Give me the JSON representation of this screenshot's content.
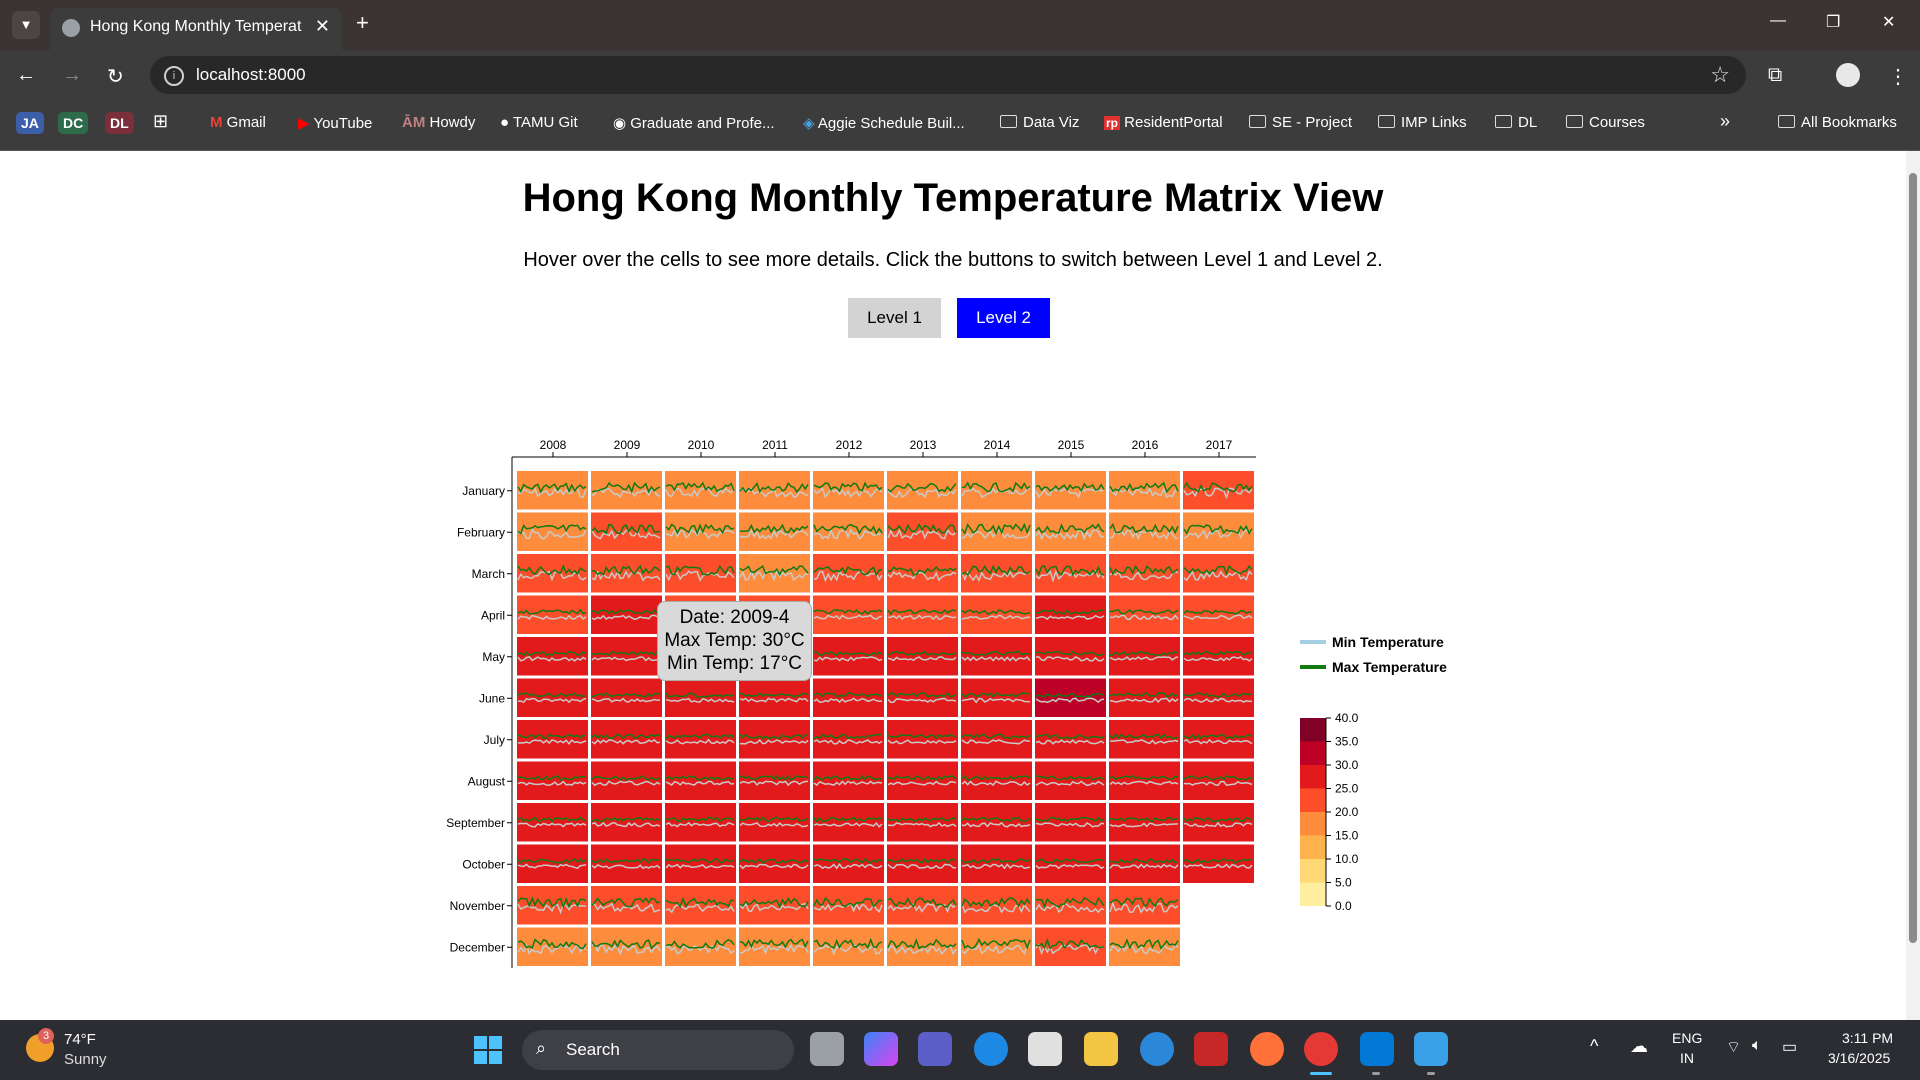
{
  "browser": {
    "tab_title": "Hong Kong Monthly Temperatu",
    "url": "localhost:8000",
    "bookmarks": [
      "JA",
      "DC",
      "DL",
      "Gmail",
      "YouTube",
      "Howdy",
      "TAMU Git",
      "Graduate and Profe...",
      "Aggie Schedule Buil...",
      "Data Viz",
      "ResidentPortal",
      "SE - Project",
      "IMP Links",
      "DL",
      "Courses",
      "All Bookmarks"
    ]
  },
  "page": {
    "title": "Hong Kong Monthly Temperature Matrix View",
    "subtitle": "Hover over the cells to see more details. Click the buttons to switch between Level 1 and Level 2.",
    "button_level1": "Level 1",
    "button_level2": "Level 2",
    "active_level": "Level 2"
  },
  "tooltip": {
    "date": "Date: 2009-4",
    "max": "Max Temp: 30°C",
    "min": "Min Temp: 17°C"
  },
  "chart_data": {
    "type": "heatmap",
    "title": "Hong Kong Monthly Temperature Matrix View",
    "years": [
      "2008",
      "2009",
      "2010",
      "2011",
      "2012",
      "2013",
      "2014",
      "2015",
      "2016",
      "2017"
    ],
    "months": [
      "January",
      "February",
      "March",
      "April",
      "May",
      "June",
      "July",
      "August",
      "September",
      "October",
      "November",
      "December"
    ],
    "monthly_max_temp_c": [
      [
        20,
        21,
        21,
        20,
        20,
        22,
        21,
        21,
        21,
        23
      ],
      [
        18,
        23,
        22,
        21,
        21,
        23,
        20,
        22,
        21,
        22
      ],
      [
        23,
        24,
        23,
        22,
        23,
        24,
        24,
        24,
        23,
        24
      ],
      [
        26,
        30,
        25,
        26,
        27,
        26,
        26,
        28,
        27,
        27
      ],
      [
        30,
        30,
        30,
        30,
        30,
        30,
        30,
        31,
        30,
        30
      ],
      [
        31,
        32,
        31,
        32,
        31,
        32,
        32,
        33,
        32,
        32
      ],
      [
        32,
        32,
        32,
        32,
        32,
        32,
        32,
        32,
        32,
        32
      ],
      [
        32,
        32,
        32,
        32,
        32,
        32,
        32,
        32,
        32,
        32
      ],
      [
        31,
        32,
        31,
        31,
        31,
        31,
        32,
        31,
        32,
        31
      ],
      [
        29,
        29,
        28,
        28,
        29,
        28,
        29,
        30,
        30,
        29
      ],
      [
        25,
        26,
        25,
        26,
        25,
        25,
        25,
        27,
        26,
        null
      ],
      [
        21,
        22,
        21,
        20,
        21,
        20,
        20,
        23,
        22,
        null
      ]
    ],
    "legend": {
      "lines": [
        {
          "name": "Min Temperature",
          "color": "#a6cee3"
        },
        {
          "name": "Max Temperature",
          "color": "#117a11"
        }
      ],
      "scale_ticks": [
        "40.0",
        "35.0",
        "30.0",
        "25.0",
        "20.0",
        "15.0",
        "10.0",
        "5.0",
        "0.0"
      ],
      "scale_colors": [
        "#800026",
        "#bd0026",
        "#e31a1c",
        "#fc4e2a",
        "#fd8d3c",
        "#feb24c",
        "#fed976",
        "#ffeda0"
      ]
    }
  },
  "taskbar": {
    "weather_temp": "74°F",
    "weather_desc": "Sunny",
    "weather_badge": "3",
    "search": "Search",
    "lang1": "ENG",
    "lang2": "IN",
    "time": "3:11 PM",
    "date": "3/16/2025"
  }
}
